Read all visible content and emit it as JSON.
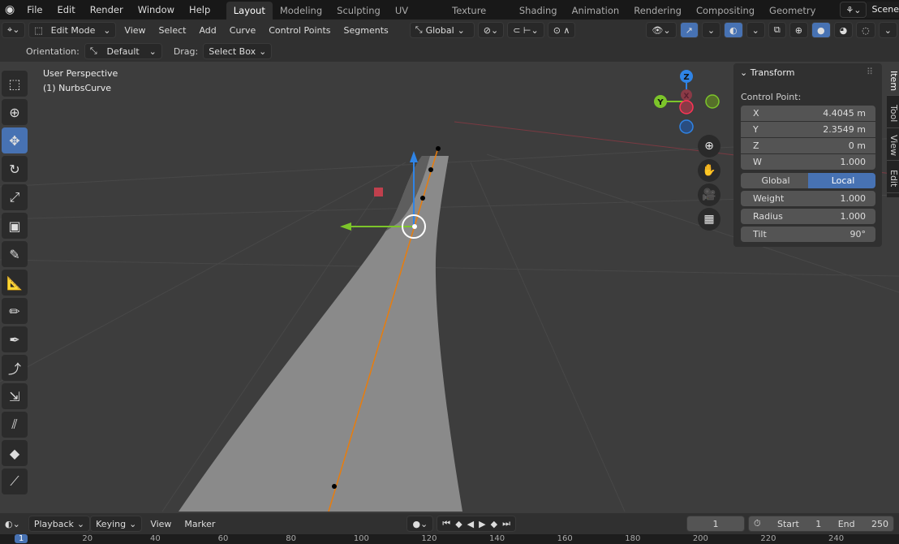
{
  "topbar": {
    "menus": [
      "File",
      "Edit",
      "Render",
      "Window",
      "Help"
    ],
    "workspaces": [
      "Layout",
      "Modeling",
      "Sculpting",
      "UV Editing",
      "Texture Paint",
      "Shading",
      "Animation",
      "Rendering",
      "Compositing",
      "Geometry Noc"
    ],
    "active_workspace": "Layout",
    "scene": "Scene"
  },
  "header": {
    "mode": "Edit Mode",
    "menus": [
      "View",
      "Select",
      "Add",
      "Curve",
      "Control Points",
      "Segments"
    ],
    "orientation": "Global"
  },
  "tool_settings": {
    "orientation_label": "Orientation:",
    "orientation_value": "Default",
    "drag_label": "Drag:",
    "drag_value": "Select Box"
  },
  "viewport": {
    "perspective": "User Perspective",
    "object": "(1) NurbsCurve",
    "accent": "#4772b3",
    "curve_color": "#e87d0d"
  },
  "gizmo": {
    "z": "Z",
    "y": "Y",
    "x": "X"
  },
  "panel": {
    "title": "Transform",
    "section": "Control Point:",
    "fields": [
      {
        "label": "X",
        "value": "4.4045 m"
      },
      {
        "label": "Y",
        "value": "2.3549 m"
      },
      {
        "label": "Z",
        "value": "0 m"
      },
      {
        "label": "W",
        "value": "1.000"
      }
    ],
    "space_global": "Global",
    "space_local": "Local",
    "space_active": "Local",
    "props": [
      {
        "label": "Weight",
        "value": "1.000"
      },
      {
        "label": "Radius",
        "value": "1.000"
      },
      {
        "label": "Tilt",
        "value": "90°"
      }
    ]
  },
  "sidebar_tabs": [
    "Item",
    "Tool",
    "View",
    "Edit"
  ],
  "timeline": {
    "menus": [
      "Playback",
      "Keying",
      "View",
      "Marker"
    ],
    "current_frame": "1",
    "start_label": "Start",
    "start": "1",
    "end_label": "End",
    "end": "250",
    "ruler": [
      "1",
      "20",
      "40",
      "60",
      "80",
      "100",
      "120",
      "140",
      "160",
      "180",
      "200",
      "220",
      "240"
    ]
  }
}
